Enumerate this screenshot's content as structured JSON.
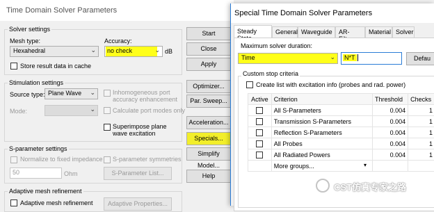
{
  "win1": {
    "title": "Time Domain Solver Parameters",
    "solver_settings": {
      "title": "Solver settings",
      "mesh_type_label": "Mesh type:",
      "mesh_type_value": "Hexahedral",
      "accuracy_label": "Accuracy:",
      "accuracy_value": "no check",
      "accuracy_unit": "dB",
      "store_result": "Store result data in cache"
    },
    "stimulation": {
      "title": "Stimulation settings",
      "source_type_label": "Source type:",
      "source_type_value": "Plane Wave",
      "mode_label": "Mode:",
      "inhomogeneous": [
        "Inhomogeneous port",
        "accuracy enhancement"
      ],
      "calc_port_modes": "Calculate port modes only",
      "superimpose": [
        "Superimpose plane",
        "wave excitation"
      ]
    },
    "sparam": {
      "title": "S-parameter settings",
      "normalize": "Normalize to fixed impedance",
      "symmetries": "S-parameter symmetries",
      "impedance_value": "50",
      "impedance_unit": "Ohm",
      "list_button": "S-Parameter List..."
    },
    "adaptive": {
      "title": "Adaptive mesh refinement",
      "checkbox": "Adaptive mesh refinement",
      "properties_button": "Adaptive Properties..."
    },
    "buttons": {
      "start": "Start",
      "close": "Close",
      "apply": "Apply",
      "optimizer": "Optimizer...",
      "par_sweep": "Par. Sweep...",
      "acceleration": "Acceleration...",
      "specials": "Specials...",
      "simplify": "Simplify Model...",
      "help": "Help"
    }
  },
  "win2": {
    "title": "Special Time Domain Solver Parameters",
    "tabs": [
      "Steady State",
      "General",
      "Waveguide",
      "AR-Filter",
      "Material",
      "Solver"
    ],
    "max_duration_label": "Maximum solver duration:",
    "duration_type": "Time",
    "duration_value": "N*T",
    "default_button": "Defau",
    "custom_stop_title": "Custom stop criteria",
    "create_list": "Create list with excitation info (probes and rad. power)",
    "table_headers": [
      "Active",
      "Criterion",
      "Threshold",
      "Checks"
    ],
    "rows": [
      {
        "criterion": "All S-Parameters",
        "threshold": "0.004",
        "checks": "1"
      },
      {
        "criterion": "Transmission S-Parameters",
        "threshold": "0.004",
        "checks": "1"
      },
      {
        "criterion": "Reflection S-Parameters",
        "threshold": "0.004",
        "checks": "1"
      },
      {
        "criterion": "All Probes",
        "threshold": "0.004",
        "checks": "1"
      },
      {
        "criterion": "All Radiated Powers",
        "threshold": "0.004",
        "checks": "1"
      }
    ],
    "more_groups": "More groups..."
  },
  "watermark": "CST仿真专家之路",
  "colors": {
    "highlight": "#ffff1a",
    "accent": "#2a7cd6"
  }
}
